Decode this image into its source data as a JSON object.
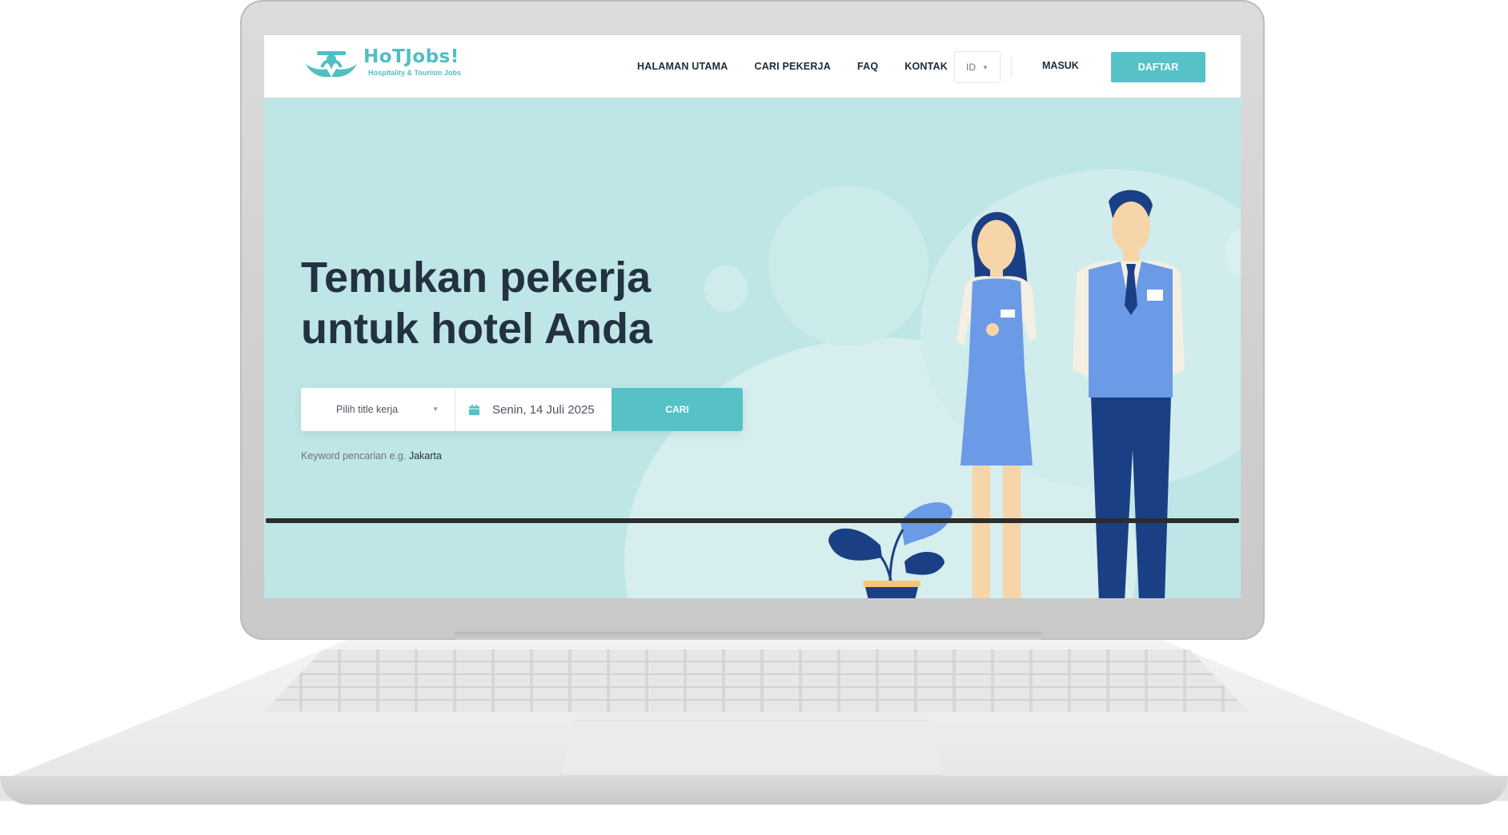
{
  "nav": {
    "logo_title": "HoTJobs!",
    "logo_subtitle": "Hospitality & Tourism Jobs",
    "links": [
      "HALAMAN UTAMA",
      "CARI PEKERJA",
      "FAQ",
      "KONTAK"
    ],
    "language": "ID",
    "login_label": "MASUK",
    "register_label": "DAFTAR"
  },
  "hero": {
    "headline_line1": "Temukan pekerja",
    "headline_line2": "untuk hotel Anda",
    "search": {
      "job_title_placeholder": "Pilih title kerja",
      "date_value": "Senin, 14 Juli 2025",
      "button_label": "CARI"
    },
    "keyword_hint": "Keyword pencarian e.g.",
    "keyword_example": "Jakarta"
  },
  "colors": {
    "accent": "#56c2c7",
    "hero_bg": "#bfe6e6",
    "text_dark": "#233240",
    "uniform_blue": "#6b9ae6",
    "navy": "#1b3f84"
  },
  "icons": {
    "lang_chevron": "chevron-down-icon",
    "select_chevron": "chevron-down-icon",
    "calendar": "calendar-icon"
  }
}
